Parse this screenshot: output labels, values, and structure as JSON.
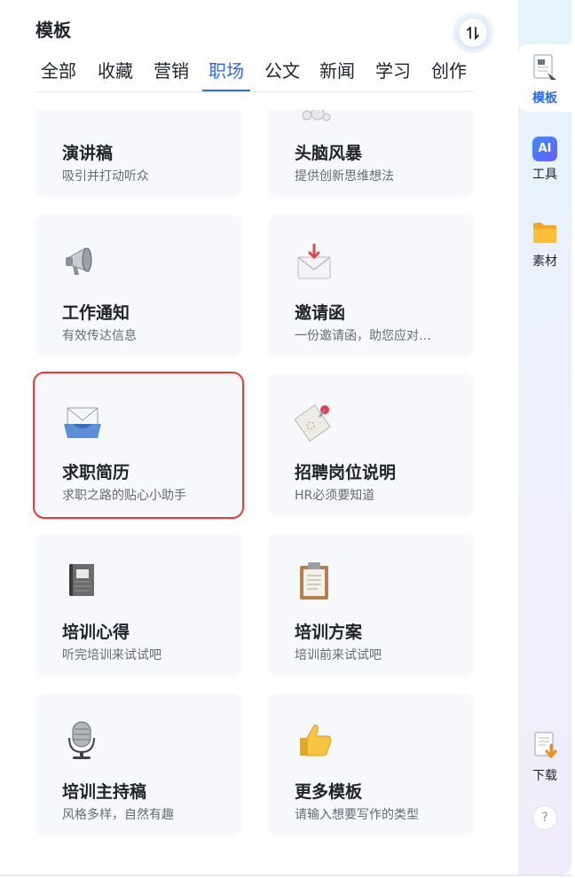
{
  "panel": {
    "title": "模板"
  },
  "tabs": [
    {
      "label": "全部"
    },
    {
      "label": "收藏"
    },
    {
      "label": "营销"
    },
    {
      "label": "职场"
    },
    {
      "label": "公文"
    },
    {
      "label": "新闻"
    },
    {
      "label": "学习"
    },
    {
      "label": "创作"
    }
  ],
  "active_tab": "职场",
  "cards": [
    {
      "title": "演讲稿",
      "desc": "吸引并打动听众",
      "icon": "microphone-icon"
    },
    {
      "title": "头脑风暴",
      "desc": "提供创新思维想法",
      "icon": "thought-bubble-icon"
    },
    {
      "title": "工作通知",
      "desc": "有效传达信息",
      "icon": "megaphone-icon"
    },
    {
      "title": "邀请函",
      "desc": "一份邀请函，助您应对…",
      "icon": "envelope-icon"
    },
    {
      "title": "求职简历",
      "desc": "求职之路的贴心小助手",
      "icon": "inbox-mail-icon"
    },
    {
      "title": "招聘岗位说明",
      "desc": "HR必须要知道",
      "icon": "pinned-note-icon"
    },
    {
      "title": "培训心得",
      "desc": "听完培训来试试吧",
      "icon": "notebook-icon"
    },
    {
      "title": "培训方案",
      "desc": "培训前来试试吧",
      "icon": "clipboard-icon"
    },
    {
      "title": "培训主持稿",
      "desc": "风格多样，自然有趣",
      "icon": "studio-mic-icon"
    },
    {
      "title": "更多模板",
      "desc": "请输入想要写作的类型",
      "icon": "thumbs-up-icon"
    }
  ],
  "selected_card": "求职简历",
  "rail": {
    "templates": "模板",
    "tools": "工具",
    "tools_badge": "AI",
    "assets": "素材",
    "download": "下载",
    "help": "?"
  },
  "colors": {
    "accent": "#2f6ae5",
    "selection": "#e53a35"
  }
}
